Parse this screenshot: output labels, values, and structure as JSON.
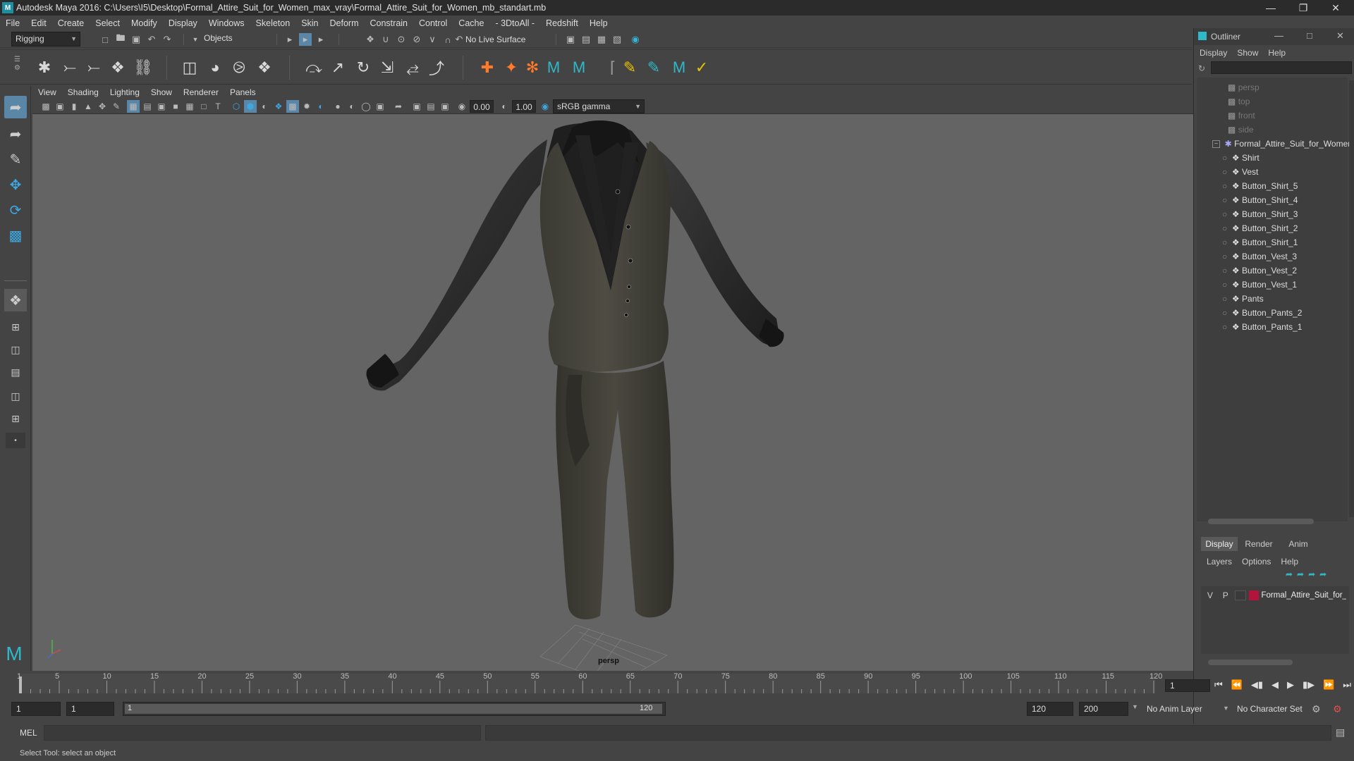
{
  "window": {
    "title": "Autodesk Maya 2016: C:\\Users\\I5\\Desktop\\Formal_Attire_Suit_for_Women_max_vray\\Formal_Attire_Suit_for_Women_mb_standart.mb",
    "logo": "M"
  },
  "menubar": [
    "File",
    "Edit",
    "Create",
    "Select",
    "Modify",
    "Display",
    "Windows",
    "Skeleton",
    "Skin",
    "Deform",
    "Constrain",
    "Control",
    "Cache",
    "- 3DtoAll -",
    "Redshift",
    "Help"
  ],
  "statusline": {
    "mode": "Rigging",
    "selection_mode": "Objects",
    "live_surface": "No Live Surface"
  },
  "panel": {
    "menu": [
      "View",
      "Shading",
      "Lighting",
      "Show",
      "Renderer",
      "Panels"
    ],
    "exposure": "0.00",
    "gamma": "1.00",
    "color_space": "sRGB gamma",
    "camera_label": "persp"
  },
  "outliner": {
    "title": "Outliner",
    "menu": [
      "Display",
      "Show",
      "Help"
    ],
    "cameras": [
      "persp",
      "top",
      "front",
      "side"
    ],
    "root": "Formal_Attire_Suit_for_Women",
    "children": [
      "Shirt",
      "Vest",
      "Button_Shirt_5",
      "Button_Shirt_4",
      "Button_Shirt_3",
      "Button_Shirt_2",
      "Button_Shirt_1",
      "Button_Vest_3",
      "Button_Vest_2",
      "Button_Vest_1",
      "Pants",
      "Button_Pants_2",
      "Button_Pants_1"
    ]
  },
  "layers": {
    "tabs": [
      "Display",
      "Render",
      "Anim"
    ],
    "menu": [
      "Layers",
      "Options",
      "Help"
    ],
    "row": {
      "v": "V",
      "p": "P",
      "name": "Formal_Attire_Suit_for_",
      "color": "#b3143c"
    }
  },
  "timeline": {
    "ticks": [
      "1",
      "5",
      "10",
      "15",
      "20",
      "25",
      "30",
      "35",
      "40",
      "45",
      "50",
      "55",
      "60",
      "65",
      "70",
      "75",
      "80",
      "85",
      "90",
      "95",
      "100",
      "105",
      "110",
      "115",
      "120"
    ],
    "current_frame": "1"
  },
  "range": {
    "start": "1",
    "playback_start": "1",
    "slider_start": "1",
    "slider_end": "120",
    "playback_end": "120",
    "end": "200",
    "anim_layer": "No Anim Layer",
    "character_set": "No Character Set"
  },
  "cmdline": {
    "lang": "MEL"
  },
  "helpline": {
    "text": "Select Tool: select an object"
  },
  "colors": {
    "accent": "#1e8fa3",
    "viewport_bg": "#646464",
    "layer_color": "#b3143c"
  }
}
